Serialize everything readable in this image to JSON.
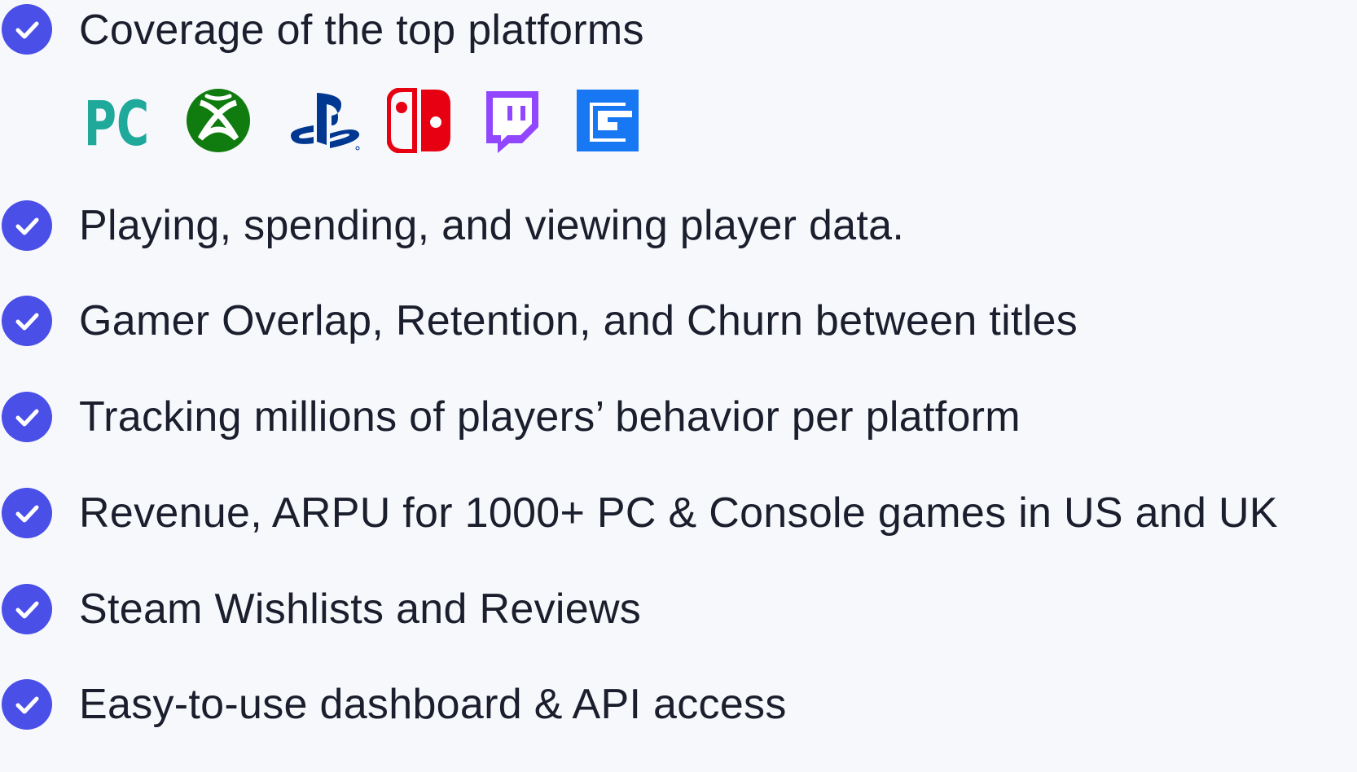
{
  "features": [
    {
      "label": "Coverage of the top platforms"
    },
    {
      "label": "Playing, spending, and viewing player data."
    },
    {
      "label": "Gamer Overlap, Retention, and Churn between titles"
    },
    {
      "label": "Tracking millions of players’ behavior per platform"
    },
    {
      "label": "Revenue, ARPU for 1000+ PC & Console games in US and UK"
    },
    {
      "label": "Steam Wishlists and Reviews"
    },
    {
      "label": "Easy-to-use dashboard & API access"
    }
  ],
  "platforms": [
    {
      "icon": "pc-logo-icon",
      "text": "PC",
      "color": "#1fa99a"
    },
    {
      "icon": "xbox-logo-icon",
      "color": "#107c10"
    },
    {
      "icon": "playstation-logo-icon",
      "color": "#003791"
    },
    {
      "icon": "nintendo-switch-logo-icon",
      "color": "#e60012"
    },
    {
      "icon": "twitch-logo-icon",
      "color": "#9146ff"
    },
    {
      "icon": "facebook-gaming-logo-icon",
      "color": "#1877f2"
    }
  ],
  "colors": {
    "check": "#4a4fe8",
    "background": "#f7f8fc",
    "text": "#1b1e2c"
  }
}
